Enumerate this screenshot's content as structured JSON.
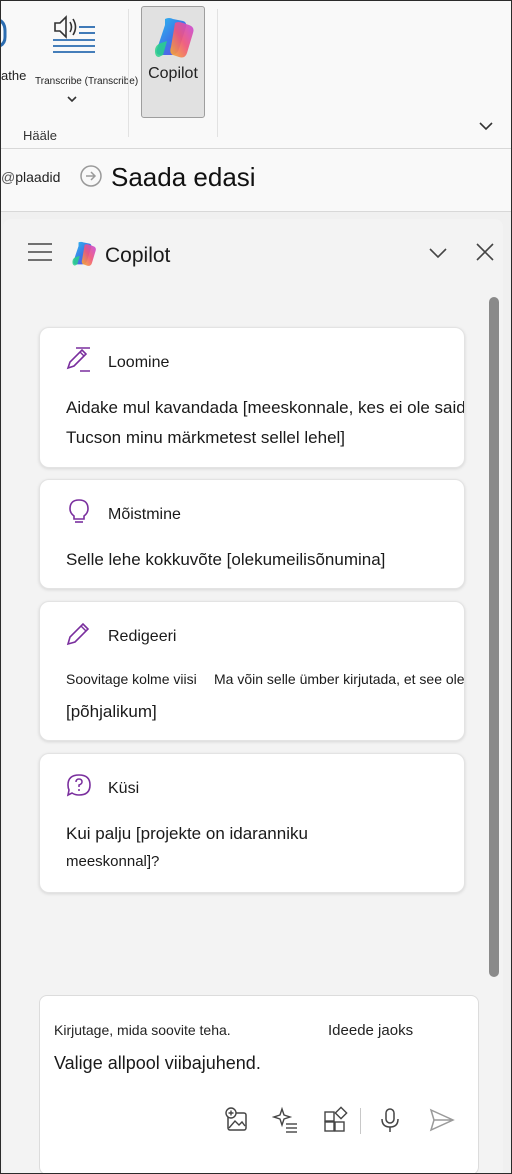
{
  "ribbon": {
    "fragment_label": "athe",
    "transcribe_label": "Transcribe (Transcribe)",
    "group_label": "Hääle",
    "copilot_label": "Copilot"
  },
  "qat": {
    "plaadid_label": "plaadid",
    "send_label": "Saada edasi"
  },
  "pane": {
    "title": "Copilot",
    "cards": [
      {
        "title": "Loomine",
        "line1": "Aidake mul kavandada [meeskonnale, kes ei ole saidil",
        "line2": "Tucson minu märkmetest sellel lehel]"
      },
      {
        "title": "Mõistmine",
        "line1": "Selle lehe kokkuvõte [olekumeilisõnumina]"
      },
      {
        "title": "Redigeeri",
        "line1a": "Soovitage kolme viisi",
        "line1b": "Ma võin selle ümber kirjutada, et see oleks",
        "line2": "[põhjalikum]"
      },
      {
        "title": "Küsi",
        "line1": "Kui palju [projekte on idaranniku",
        "line2": "meeskonnal]?"
      }
    ],
    "composer": {
      "placeholder_a": "Kirjutage, mida soovite teha.",
      "placeholder_b": "Ideede jaoks",
      "placeholder_c": "Valige allpool viibajuhend."
    }
  },
  "colors": {
    "accent_purple": "#7a2f9e",
    "icon_dark": "#555555",
    "ribbon_blue": "#2b6cb0"
  },
  "icons": [
    "microphone-icon",
    "transcribe-icon",
    "copilot-logo-icon",
    "chevron-down-icon",
    "forward-arrow-icon",
    "hamburger-menu-icon",
    "close-icon",
    "pencil-sparkle-icon",
    "lightbulb-icon",
    "pencil-icon",
    "question-bubble-icon",
    "add-image-icon",
    "sparkle-list-icon",
    "apps-icon",
    "microphone-icon",
    "send-icon"
  ]
}
